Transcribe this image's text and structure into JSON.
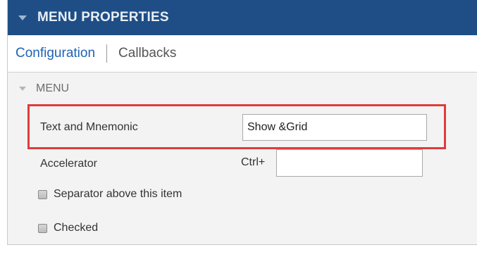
{
  "panel": {
    "title": "MENU PROPERTIES"
  },
  "tabs": [
    {
      "label": "Configuration",
      "active": true
    },
    {
      "label": "Callbacks",
      "active": false
    }
  ],
  "section": {
    "label": "MENU"
  },
  "fields": {
    "text_mnemonic": {
      "label": "Text and Mnemonic",
      "value": "Show &Grid"
    },
    "accelerator": {
      "label": "Accelerator",
      "prefix": "Ctrl+",
      "value": ""
    }
  },
  "checkboxes": [
    {
      "label": "Separator above this item",
      "checked": false
    },
    {
      "label": "Checked",
      "checked": false
    }
  ],
  "colors": {
    "header_bg": "#1f4e86",
    "active_tab": "#1f63b3",
    "highlight_border": "#e03b3b"
  }
}
